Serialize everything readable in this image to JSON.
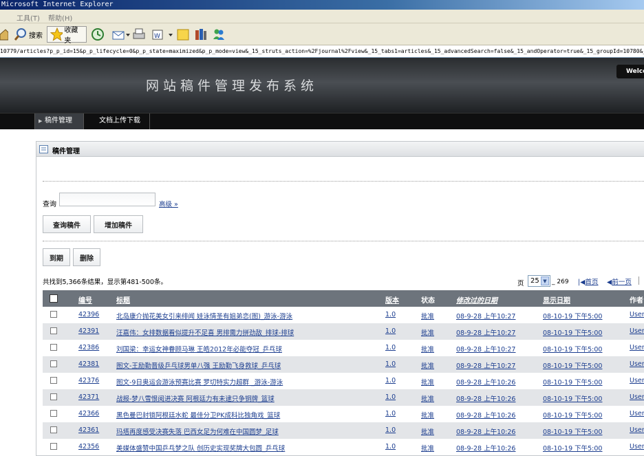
{
  "window": {
    "title": "Microsoft Internet Explorer"
  },
  "menu": [
    {
      "label": "工具(T)"
    },
    {
      "label": "帮助(H)"
    }
  ],
  "toolbar": {
    "search": "搜索",
    "favorites": "收藏夹"
  },
  "address": "10779/articles?p_p_id=15&p_p_lifecycle=0&p_p_state=maximized&p_p_mode=view&_15_struts_action=%2Fjournal%2Fview&_15_tabs1=articles&_15_advancedSearch=false&_15_andOperator=true&_15_groupId=10780&_15",
  "site": {
    "title": "网站稿件管理发布系统",
    "welcome": "Welco"
  },
  "nav": [
    {
      "label": "稿件管理"
    },
    {
      "label": "文档上传下载"
    }
  ],
  "portlet": {
    "title": "稿件管理"
  },
  "search": {
    "label": "查询",
    "value": "",
    "advanced": "高级 »"
  },
  "buttons": {
    "search": "查询稿件",
    "add": "增加稿件",
    "expire": "到期",
    "delete": "删除"
  },
  "results": {
    "summary": "共找到5,366条结果，显示第481-500条。",
    "page_label": "页",
    "page_value": "25",
    "page_total": "_ 269",
    "first": "首页",
    "prev": "前一页"
  },
  "table": {
    "headers": {
      "id": "编号",
      "title": "标题",
      "version": "版本",
      "status": "状态",
      "modified": "修改过的日期",
      "display": "显示日期",
      "author": "作者"
    },
    "rows": [
      {
        "id": "42396",
        "title": "北岛康介抛花美女引来绯闻 娃泳情圣有姐弟恋(图)_游泳-游泳",
        "version": "1.0",
        "status": "批准",
        "modified": "08-9-28 上午10:27",
        "display": "08-10-19 下午5:00",
        "author": "User"
      },
      {
        "id": "42391",
        "title": "汪嘉伟：女排数据看似提升不足喜 男排需力拼劲敌_排球-排球",
        "version": "1.0",
        "status": "批准",
        "modified": "08-9-28 上午10:27",
        "display": "08-10-19 下午5:00",
        "author": "User"
      },
      {
        "id": "42386",
        "title": "刘国梁：幸运女神眷顾马琳 王皓2012年必能夺冠_乒乓球",
        "version": "1.0",
        "status": "批准",
        "modified": "08-9-28 上午10:27",
        "display": "08-10-19 下午5:00",
        "author": "User"
      },
      {
        "id": "42381",
        "title": "图文-王励勤晋级乒乓球男单八强 王励勤飞身救球_乒乓球",
        "version": "1.0",
        "status": "批准",
        "modified": "08-9-28 上午10:27",
        "display": "08-10-19 下午5:00",
        "author": "User"
      },
      {
        "id": "42376",
        "title": "图文-9日奥运会游泳预赛比赛 罗切特实力超群 _游泳-游泳",
        "version": "1.0",
        "status": "批准",
        "modified": "08-9-28 上午10:26",
        "display": "08-10-19 下午5:00",
        "author": "User"
      },
      {
        "id": "42371",
        "title": "战报-梦八雪恨阅进决赛 阿根廷力有未逮只争铜牌_篮球",
        "version": "1.0",
        "status": "批准",
        "modified": "08-9-28 上午10:26",
        "display": "08-10-19 下午5:00",
        "author": "User"
      },
      {
        "id": "42366",
        "title": "黑色曼巴封锁阿根廷水蛇 最佳分卫PK成科比独角戏_篮球",
        "version": "1.0",
        "status": "批准",
        "modified": "08-9-28 上午10:26",
        "display": "08-10-19 下午5:00",
        "author": "User"
      },
      {
        "id": "42361",
        "title": "玛塔再度感受决赛失落 巴西女足为何难在中国圆梦_足球",
        "version": "1.0",
        "status": "批准",
        "modified": "08-9-28 上午10:26",
        "display": "08-10-19 下午5:00",
        "author": "User"
      },
      {
        "id": "42356",
        "title": "美媒体盛赞中国乒乓梦之队 创历史实现奖牌大包圆_乒乓球",
        "version": "1.0",
        "status": "批准",
        "modified": "08-9-28 上午10:26",
        "display": "08-10-19 下午5:00",
        "author": "User"
      }
    ]
  }
}
